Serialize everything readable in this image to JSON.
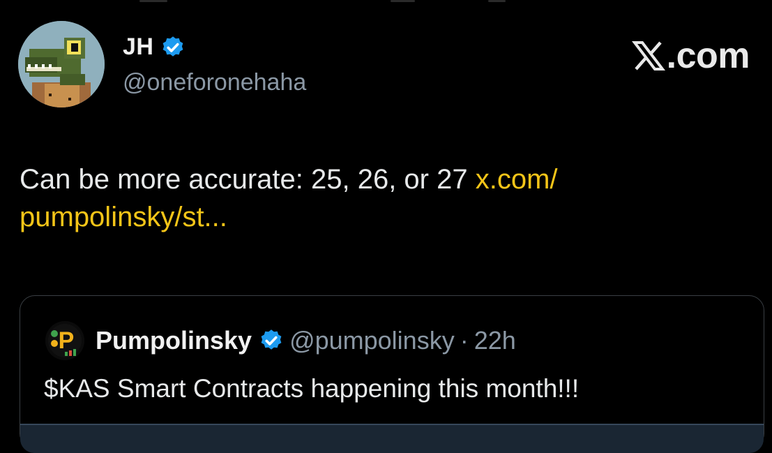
{
  "author": {
    "display_name": "JH",
    "handle": "@oneforonehaha",
    "verified": true
  },
  "source_label": ".com",
  "tweet": {
    "text": "Can be more accurate: 25, 26, or 27 ",
    "link_text": "x.com/\npumpolinsky/st..."
  },
  "quote": {
    "display_name": "Pumpolinsky",
    "handle": "@pumpolinsky",
    "separator": "·",
    "time": "22h",
    "text": "$KAS Smart Contracts happening this month!!!",
    "avatar_letter": "P",
    "verified": true
  },
  "colors": {
    "background": "#000000",
    "link": "#f5c518",
    "verified_badge": "#1d9bf0",
    "secondary_text": "#8b98a5"
  },
  "icons": [
    "verified-badge-icon",
    "x-logo-icon"
  ]
}
